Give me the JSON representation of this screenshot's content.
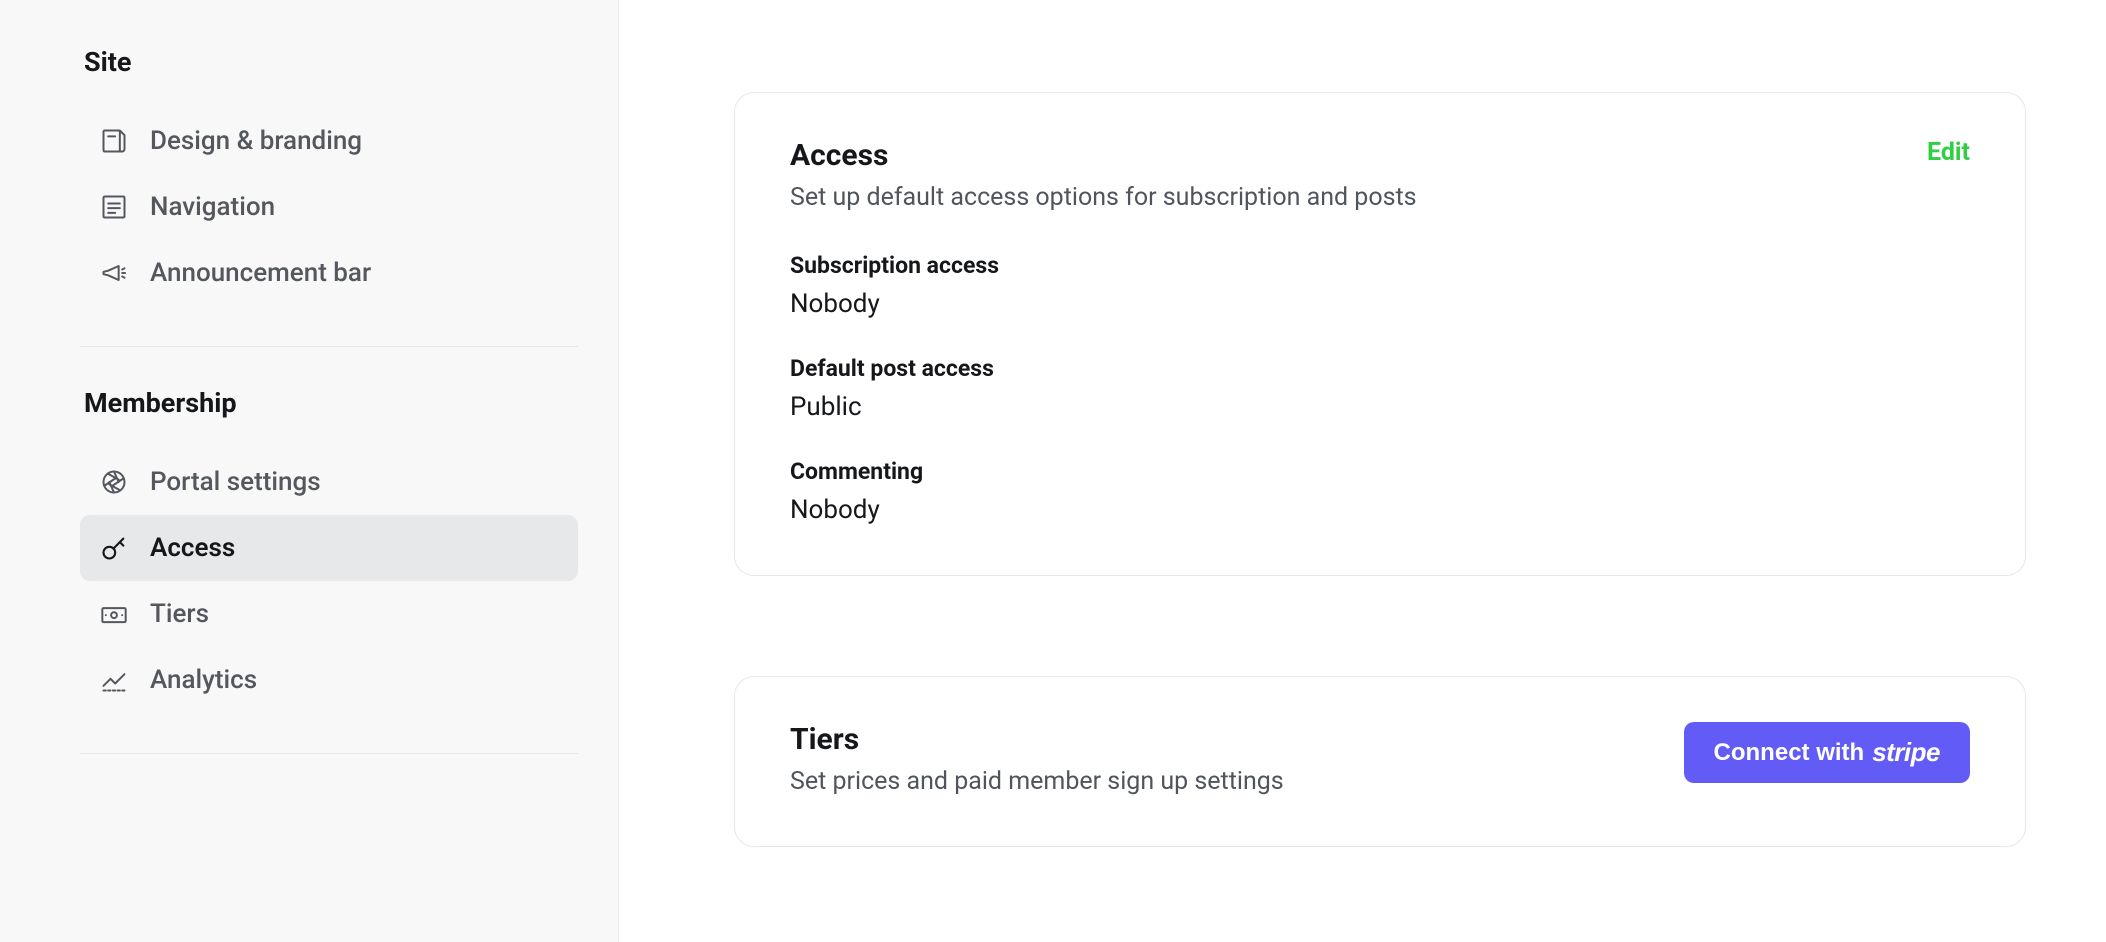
{
  "sidebar": {
    "sections": [
      {
        "heading": "Site",
        "items": [
          {
            "label": "Design & branding",
            "active": false
          },
          {
            "label": "Navigation",
            "active": false
          },
          {
            "label": "Announcement bar",
            "active": false
          }
        ]
      },
      {
        "heading": "Membership",
        "items": [
          {
            "label": "Portal settings",
            "active": false
          },
          {
            "label": "Access",
            "active": true
          },
          {
            "label": "Tiers",
            "active": false
          },
          {
            "label": "Analytics",
            "active": false
          }
        ]
      }
    ]
  },
  "access_card": {
    "title": "Access",
    "subtitle": "Set up default access options for subscription and posts",
    "edit_label": "Edit",
    "fields": {
      "subscription_access": {
        "label": "Subscription access",
        "value": "Nobody"
      },
      "default_post_access": {
        "label": "Default post access",
        "value": "Public"
      },
      "commenting": {
        "label": "Commenting",
        "value": "Nobody"
      }
    }
  },
  "tiers_card": {
    "title": "Tiers",
    "subtitle": "Set prices and paid member sign up settings",
    "connect_button": {
      "prefix": "Connect with",
      "brand": "stripe"
    }
  }
}
